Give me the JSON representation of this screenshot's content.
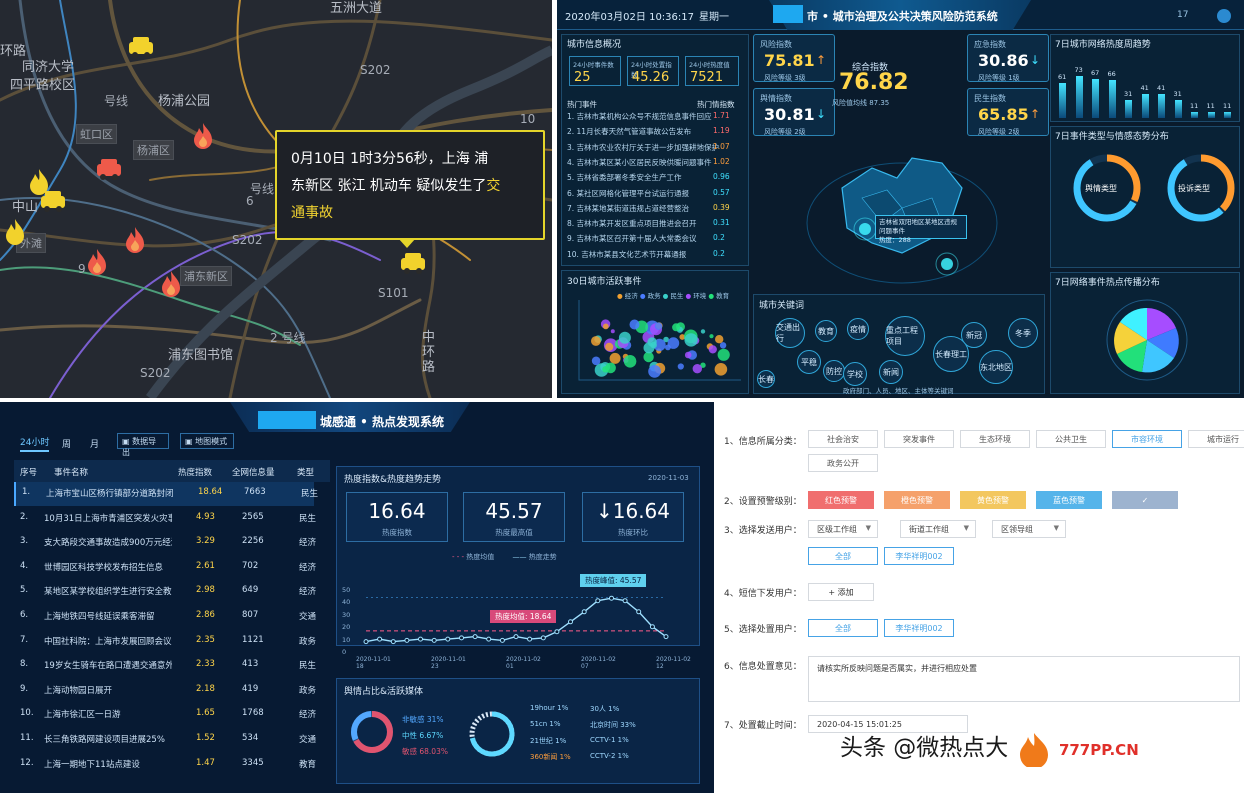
{
  "map": {
    "labels": [
      {
        "t": "五洲大道"
      },
      {
        "t": "环路"
      },
      {
        "t": "同济大学"
      },
      {
        "t": "四平路校区"
      },
      {
        "t": "杨浦公园"
      },
      {
        "t": "号线"
      },
      {
        "t": "虹口区"
      },
      {
        "t": "杨浦区"
      },
      {
        "t": "S202"
      },
      {
        "t": "中山"
      },
      {
        "t": "浦东新区"
      },
      {
        "t": "S101"
      },
      {
        "t": "2 号线"
      },
      {
        "t": "中环路"
      },
      {
        "t": "浦东图书馆"
      },
      {
        "t": "S202"
      },
      {
        "t": "外滩"
      },
      {
        "t": "号线"
      },
      {
        "t": "S202"
      },
      {
        "t": "6"
      },
      {
        "t": "10"
      },
      {
        "t": "9"
      }
    ],
    "popup": {
      "line1": "0月10日 1时3分56秒，上海 浦",
      "line2a": "东新区 张江 机动车 疑似发生了",
      "line2b": "交",
      "line3": "通事故"
    }
  },
  "dash": {
    "time": "2020年03月02日 10:36:17",
    "weekday": "星期一",
    "title": "市 • 城市治理及公共决策风险防范系统",
    "corner_num": "17",
    "left_summary_title": "城市信息概况",
    "summary": [
      {
        "k": "24小时事件数",
        "v": "25"
      },
      {
        "k": "24小时处置指数",
        "v": "45.26"
      },
      {
        "k": "24小时热度值",
        "v": "7521"
      }
    ],
    "list_title_left": "热门事件",
    "list_title_right": "热门情指数",
    "list": [
      {
        "t": "1. 吉林市某机构公众号不规范信息事件回应",
        "v": "1.71"
      },
      {
        "t": "2. 11月长春天然气管道事故公告发布",
        "v": "1.19"
      },
      {
        "t": "3. 吉林市农业农村厅关于进一步加强耕地保护",
        "v": "1.07"
      },
      {
        "t": "4. 吉林市某区某小区居民反映供暖问题事件",
        "v": "1.02"
      },
      {
        "t": "5. 吉林省委部署冬季安全生产工作",
        "v": "0.96"
      },
      {
        "t": "6. 某社区网格化管理平台试运行通报",
        "v": "0.57"
      },
      {
        "t": "7. 吉林某地某街道违规占道经营整治",
        "v": "0.39"
      },
      {
        "t": "8. 吉林市某开发区重点项目推进会召开",
        "v": "0.31"
      },
      {
        "t": "9. 吉林市某区召开第十届人大常委会议",
        "v": "0.2"
      },
      {
        "t": "10. 吉林市某县文化艺术节开幕通报",
        "v": "0.2"
      }
    ],
    "kpis": [
      {
        "k": "风险指数",
        "v": "75.81",
        "s": "风险等级 3级"
      },
      {
        "k": "综合指数",
        "v": "76.82",
        "s": "风险值均线 87.35"
      },
      {
        "k": "应急指数",
        "v": "30.86",
        "s": "风险等级 1级"
      },
      {
        "k": "舆情指数",
        "v": "30.81",
        "s": "风险等级 2级"
      },
      {
        "k": "民生指数",
        "v": "65.85",
        "s": "风险等级 2级"
      }
    ],
    "center_label": "综合指数",
    "bar_title": "7日城市网络热度周趋势",
    "bar_vals": [
      {
        "v": "61"
      },
      {
        "v": "73"
      },
      {
        "v": "67"
      },
      {
        "v": "66"
      },
      {
        "v": "31"
      },
      {
        "v": "41"
      },
      {
        "v": "41"
      },
      {
        "v": "31"
      },
      {
        "v": "11"
      },
      {
        "v": "11"
      },
      {
        "v": "11"
      }
    ],
    "donut_title": "7日事件类型与情感态势分布",
    "donut1": "舆情类型",
    "donut2": "投诉类型",
    "pie_title": "7日网络事件热点传播分布",
    "scatter_title": "30日城市活跃事件",
    "scatter_legend": [
      "经济",
      "政务",
      "民生",
      "环境",
      "教育"
    ],
    "map_tip_line1": "吉林省双阳地区某地区违规问题事件",
    "map_tip_line2": "热度：288",
    "keyword_title": "城市关键词",
    "keywords": [
      {
        "t": "交通出行"
      },
      {
        "t": "教育"
      },
      {
        "t": "疫情"
      },
      {
        "t": "重点工程项目"
      },
      {
        "t": "新冠"
      },
      {
        "t": "冬季"
      },
      {
        "t": "长春理工"
      },
      {
        "t": "平稳"
      },
      {
        "t": "防控"
      },
      {
        "t": "学校"
      },
      {
        "t": "新闻"
      },
      {
        "t": "东北地区"
      },
      {
        "t": "长春"
      }
    ],
    "keyword_footer": "政府部门、人员、地区、主体等关键词"
  },
  "hot": {
    "title_suffix": "城感通 • 热点发现系统",
    "tabs": [
      "24小时",
      "周",
      "月"
    ],
    "btn1": "数据导出",
    "btn2": "地图模式",
    "headers": [
      "序号",
      "事件名称",
      "热度指数",
      "全网信息量",
      "类型"
    ],
    "rows": [
      {
        "n": "1.",
        "t": "上海市宝山区杨行镇部分道路封闭",
        "h": "18.64",
        "c": "7663",
        "ty": "民生"
      },
      {
        "n": "2.",
        "t": "10月31日上海市青浦区突发火灾事故",
        "h": "4.93",
        "c": "2565",
        "ty": "民生"
      },
      {
        "n": "3.",
        "t": "支大路段交通事故造成900万元经济损失",
        "h": "3.29",
        "c": "2256",
        "ty": "经济"
      },
      {
        "n": "4.",
        "t": "世博园区科技学校发布招生信息",
        "h": "2.61",
        "c": "702",
        "ty": "经济"
      },
      {
        "n": "5.",
        "t": "某地区某学校组织学生进行安全教育",
        "h": "2.98",
        "c": "649",
        "ty": "经济"
      },
      {
        "n": "6.",
        "t": "上海地铁四号线延误乘客滞留",
        "h": "2.86",
        "c": "807",
        "ty": "交通"
      },
      {
        "n": "7.",
        "t": "中国社科院：上海市发展回顾会议召开",
        "h": "2.35",
        "c": "1121",
        "ty": "政务"
      },
      {
        "n": "8.",
        "t": "19岁女生骑车在路口遭遇交通意外",
        "h": "2.33",
        "c": "413",
        "ty": "民生"
      },
      {
        "n": "9.",
        "t": "上海动物园日展开",
        "h": "2.18",
        "c": "419",
        "ty": "政务"
      },
      {
        "n": "10.",
        "t": "上海市徐汇区一日游",
        "h": "1.65",
        "c": "1768",
        "ty": "经济"
      },
      {
        "n": "11.",
        "t": "长三角铁路网建设项目进展25%",
        "h": "1.52",
        "c": "534",
        "ty": "交通"
      },
      {
        "n": "12.",
        "t": "上海一期地下11站点建设",
        "h": "1.47",
        "c": "3345",
        "ty": "教育"
      }
    ],
    "chart_title": "热度指数&热度趋势走势",
    "chart_date": "2020-11-03",
    "stats": [
      {
        "v": "16.64",
        "l": "热度指数"
      },
      {
        "v": "45.57",
        "l": "热度最高值"
      },
      {
        "v": "16.64",
        "l": "热度环比"
      }
    ],
    "legend": [
      "热度均值",
      "热度走势"
    ],
    "peak_label": "热度峰值: 45.57",
    "avg_label": "热度均值: 18.64",
    "x_labels": [
      "2020-11-01 18",
      "2020-11-01 23",
      "2020-11-02 01",
      "2020-11-02 07",
      "2020-11-02 12"
    ],
    "y_labels": [
      "50",
      "40",
      "30",
      "20",
      "10",
      "0"
    ],
    "source_title": "舆情占比&活跃媒体",
    "pie_labels": [
      {
        "t": "非敏感 31%"
      },
      {
        "t": "中性 6.67%"
      },
      {
        "t": "敏感 68.03%"
      }
    ],
    "media": [
      {
        "t": "19hour 1%"
      },
      {
        "t": "30人 1%"
      },
      {
        "t": "51cn 1%"
      },
      {
        "t": "北京时间 33%"
      },
      {
        "t": "21世纪 1%"
      },
      {
        "t": "CCTV-1 1%"
      },
      {
        "t": "360新闻 1%"
      },
      {
        "t": "CCTV-2 1%"
      }
    ]
  },
  "form": {
    "labels": [
      "1、信息所属分类：",
      "2、设置预警级别：",
      "3、选择发送用户：",
      "4、短信下发用户：",
      "5、选择处置用户：",
      "6、信息处置意见：",
      "7、处置截止时间："
    ],
    "categories": [
      {
        "t": "社会治安",
        "sel": false
      },
      {
        "t": "突发事件",
        "sel": false
      },
      {
        "t": "生态环境",
        "sel": false
      },
      {
        "t": "公共卫生",
        "sel": false
      },
      {
        "t": "市容环境",
        "sel": true
      },
      {
        "t": "城市运行",
        "sel": false
      },
      {
        "t": "政务公开",
        "sel": false
      }
    ],
    "levels": [
      {
        "t": "红色预警",
        "c": "#f06e6e"
      },
      {
        "t": "橙色预警",
        "c": "#f5a16b"
      },
      {
        "t": "黄色预警",
        "c": "#f3c75f"
      },
      {
        "t": "蓝色预警",
        "c": "#55b4ea"
      },
      {
        "t": "✓",
        "c": "#9db3cf"
      }
    ],
    "dropdowns": [
      "区级工作组",
      "街道工作组",
      "区领导组"
    ],
    "chips_send": [
      "全部",
      "李华祥明002"
    ],
    "add_label": "+ 添加",
    "chips_handle": [
      "全部",
      "李华祥明002"
    ],
    "opinion": "请核实所反映问题是否属实，并进行相应处置",
    "deadline": "2020-04-15 15:01:25"
  },
  "watermark": {
    "t1": "头条 @微热点大",
    "t2": "777PP.CN"
  }
}
